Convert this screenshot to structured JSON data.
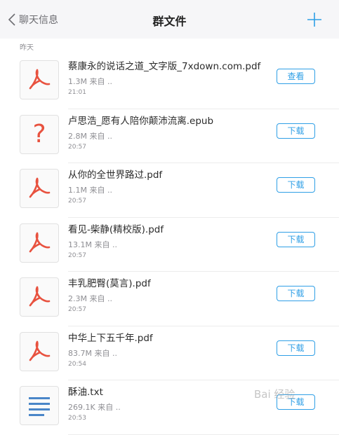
{
  "nav": {
    "back_label": "聊天信息",
    "title": "群文件"
  },
  "section_label": "昨天",
  "files": [
    {
      "name": "蔡康永的说话之道_文字版_7xdown.com.pdf",
      "size": "1.3M",
      "source": "来自 ..",
      "time": "21:01",
      "action": "查看",
      "icon": "pdf-icon"
    },
    {
      "name": "卢思浩_愿有人陪你颠沛流离.epub",
      "size": "2.8M",
      "source": "来自 ..",
      "time": "20:57",
      "action": "下载",
      "icon": "unknown-file-icon"
    },
    {
      "name": "从你的全世界路过.pdf",
      "size": "1.1M",
      "source": "来自 ..",
      "time": "20:57",
      "action": "下载",
      "icon": "pdf-icon"
    },
    {
      "name": "看见-柴静(精校版).pdf",
      "size": "13.1M",
      "source": "来自 ..",
      "time": "20:57",
      "action": "下载",
      "icon": "pdf-icon"
    },
    {
      "name": "丰乳肥臀(莫言).pdf",
      "size": "2.3M",
      "source": "来自 ..",
      "time": "20:57",
      "action": "下载",
      "icon": "pdf-icon"
    },
    {
      "name": "中华上下五千年.pdf",
      "size": "83.7M",
      "source": "来自 ..",
      "time": "20:54",
      "action": "下载",
      "icon": "pdf-icon"
    },
    {
      "name": "酥油.txt",
      "size": "269.1K",
      "source": "来自 ..",
      "time": "20:53",
      "action": "下载",
      "icon": "text-file-icon"
    }
  ],
  "watermark": "Bai 经验",
  "colors": {
    "accent": "#2f9fe6",
    "pdf_red": "#e8523f",
    "text_lines": "#4a86c8"
  }
}
